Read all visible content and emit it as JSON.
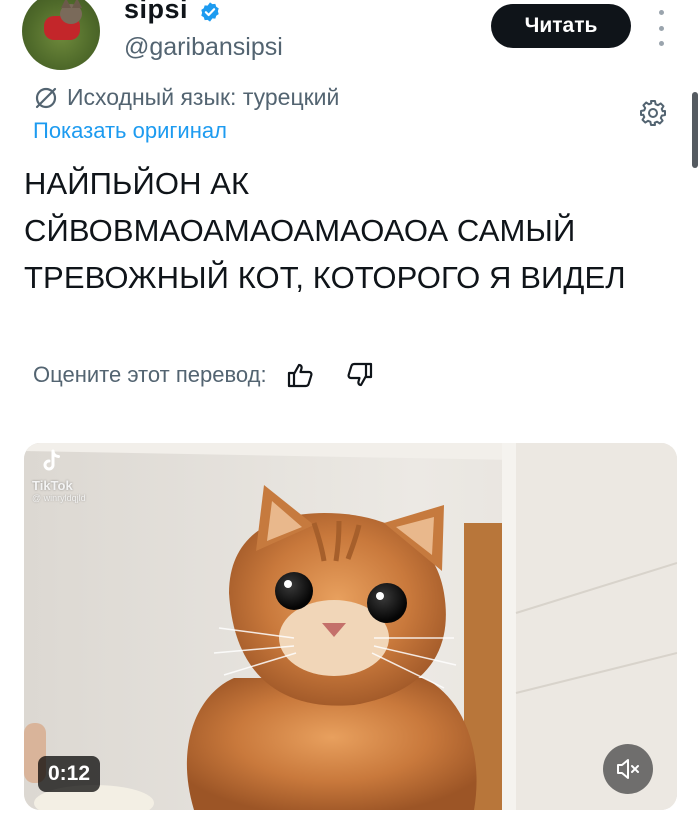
{
  "header": {
    "display_name": "sipsi",
    "handle": "@garibansipsi",
    "follow_label": "Читать"
  },
  "translation": {
    "source_language": "Исходный язык: турецкий",
    "show_original_label": "Показать оригинал"
  },
  "tweet": {
    "text": "НАЙПЬЙОН АК СЙВОВМАОАМАОАМАОАОА САМЫЙ ТРЕВОЖНЫЙ КОТ, КОТОРОГО Я ВИДЕЛ"
  },
  "rating": {
    "label": "Оцените этот перевод:"
  },
  "media": {
    "watermark_brand": "TikTok",
    "watermark_user": "@ winryldqjld",
    "duration": "0:12"
  },
  "icons": {
    "verified": "verified-badge-icon",
    "translate": "translate-icon",
    "settings": "gear-icon",
    "thumb_up": "thumb-up-icon",
    "thumb_down": "thumb-down-icon",
    "mute": "speaker-muted-icon",
    "more": "more-vertical-icon"
  },
  "colors": {
    "accent": "#1d9bf0",
    "text_primary": "#0f1419",
    "text_secondary": "#536471",
    "follow_button": "#0f1419"
  }
}
